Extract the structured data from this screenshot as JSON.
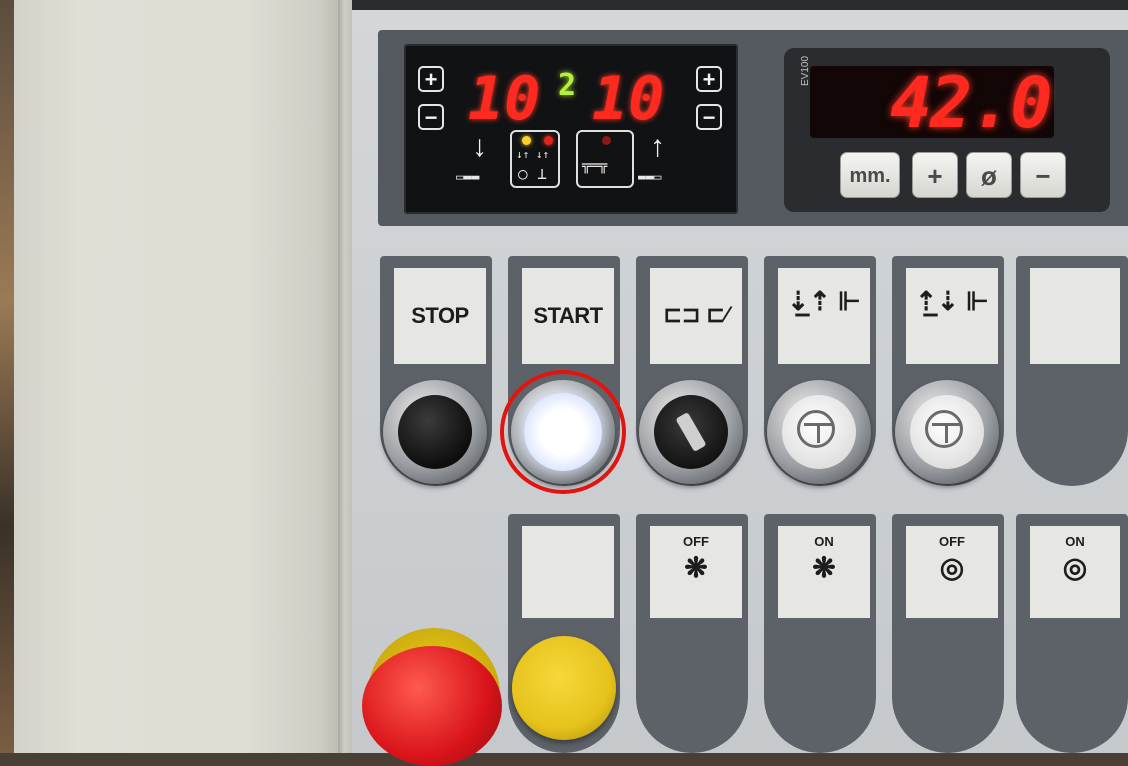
{
  "timer_display": {
    "left_value": "10",
    "center_value": "2",
    "right_value": "10",
    "plus_label": "+",
    "minus_label": "−"
  },
  "length_counter": {
    "model": "EV100",
    "value": "42.0",
    "buttons": [
      "mm.",
      "+",
      "ø",
      "−"
    ]
  },
  "buttons_row1": [
    {
      "label": "STOP"
    },
    {
      "label": "START"
    },
    {
      "label": ""
    },
    {
      "label": ""
    },
    {
      "label": ""
    },
    {
      "label": ""
    }
  ],
  "buttons_row2": [
    {
      "label": ""
    },
    {
      "label": "OFF"
    },
    {
      "label": "ON"
    },
    {
      "label": "OFF"
    },
    {
      "label": "ON"
    }
  ],
  "colors": {
    "display_red": "#ff2a1f",
    "display_green": "#b5f03a",
    "highlight": "#e3130f",
    "panel_dark": "#5d6268",
    "emergency_red": "#d9141a",
    "reset_yellow": "#e6c21b"
  },
  "icons": {
    "arrow_down": "↓",
    "arrow_up": "↑",
    "key_switch": "key-switch-icon",
    "fan": "❋",
    "brush": "◎"
  }
}
